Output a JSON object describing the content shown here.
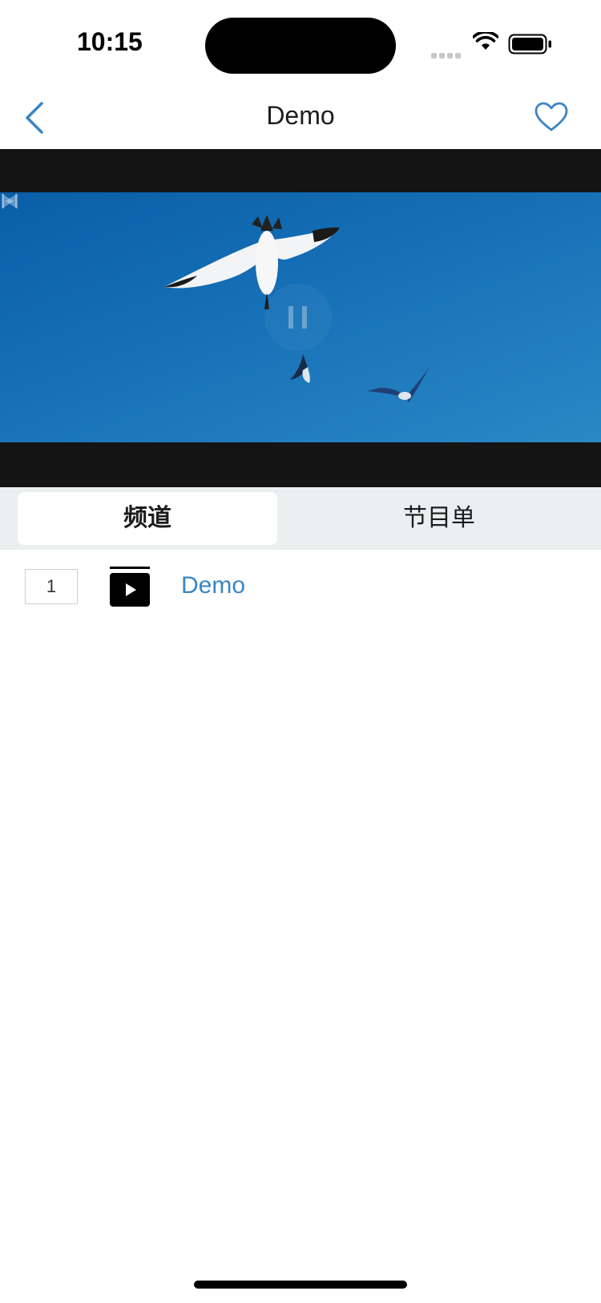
{
  "status_bar": {
    "time": "10:15"
  },
  "nav": {
    "title": "Demo",
    "back_icon": "chevron-left-icon",
    "favorite_icon": "heart-icon"
  },
  "player": {
    "controls": [
      "previous-icon",
      "pause-icon",
      "next-icon"
    ]
  },
  "tabs": [
    {
      "label": "频道",
      "selected": true
    },
    {
      "label": "节目单",
      "selected": false
    }
  ],
  "channels": [
    {
      "number": "1",
      "name": "Demo",
      "icon": "tv-play-icon"
    }
  ],
  "colors": {
    "accent": "#3a86c4",
    "tab_bar_bg": "#ecefef",
    "player_bg": "#141414"
  }
}
